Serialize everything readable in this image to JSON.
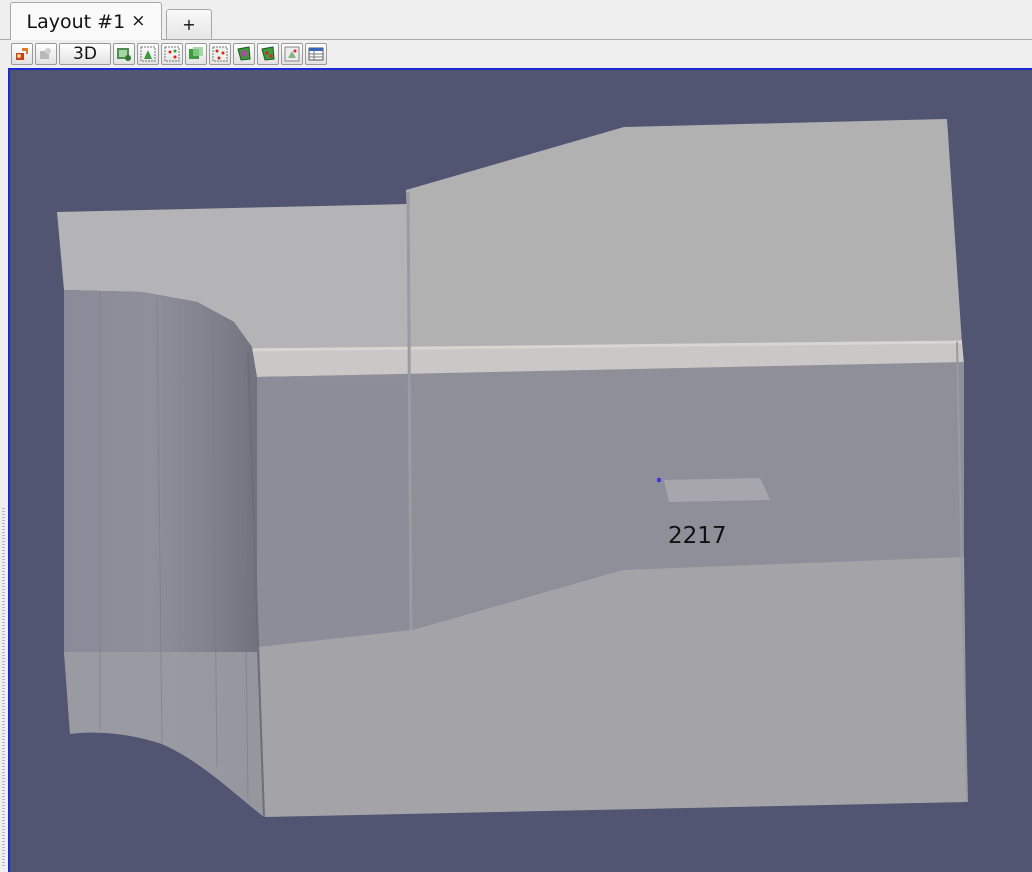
{
  "tabs": {
    "active_label": "Layout #1",
    "close_glyph": "×",
    "new_tab_label": "+"
  },
  "toolbar": {
    "buttons": [
      {
        "icon": "reset-camera-icon"
      },
      {
        "icon": "disabled-camera-icon"
      },
      {
        "label": "3D"
      },
      {
        "icon": "capture-screenshot-icon"
      },
      {
        "icon": "select-cells-on-icon"
      },
      {
        "icon": "select-points-on-icon"
      },
      {
        "icon": "select-cells-through-icon"
      },
      {
        "icon": "select-points-through-icon"
      },
      {
        "icon": "select-cells-polygon-icon"
      },
      {
        "icon": "select-points-polygon-icon"
      },
      {
        "icon": "interactive-select-icon"
      },
      {
        "icon": "spreadsheet-view-icon"
      }
    ],
    "mode_label": "3D"
  },
  "view": {
    "background_color": "#525571",
    "border_color": "#1a2bd1",
    "point_label": "2217",
    "point_marker_color": "#3a3ae0"
  }
}
